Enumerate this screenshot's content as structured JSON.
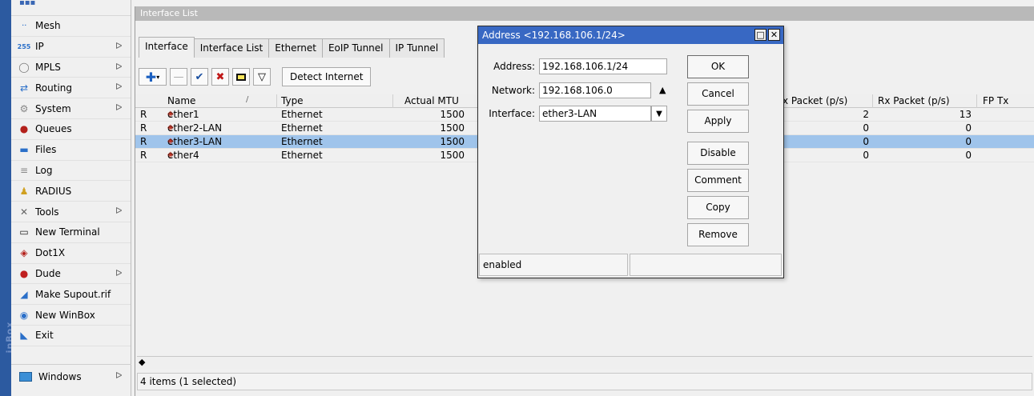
{
  "sidebar": {
    "items": [
      {
        "label": "Mesh",
        "icon": "mesh-icon",
        "arrow": false
      },
      {
        "label": "IP",
        "icon": "ip-icon",
        "arrow": true
      },
      {
        "label": "MPLS",
        "icon": "mpls-icon",
        "arrow": true
      },
      {
        "label": "Routing",
        "icon": "routing-icon",
        "arrow": true
      },
      {
        "label": "System",
        "icon": "system-icon",
        "arrow": true
      },
      {
        "label": "Queues",
        "icon": "queues-icon",
        "arrow": false
      },
      {
        "label": "Files",
        "icon": "files-icon",
        "arrow": false
      },
      {
        "label": "Log",
        "icon": "log-icon",
        "arrow": false
      },
      {
        "label": "RADIUS",
        "icon": "radius-icon",
        "arrow": false
      },
      {
        "label": "Tools",
        "icon": "tools-icon",
        "arrow": true
      },
      {
        "label": "New Terminal",
        "icon": "terminal-icon",
        "arrow": false
      },
      {
        "label": "Dot1X",
        "icon": "dot1x-icon",
        "arrow": false
      },
      {
        "label": "Dude",
        "icon": "dude-icon",
        "arrow": true
      },
      {
        "label": "Make Supout.rif",
        "icon": "supout-icon",
        "arrow": false
      },
      {
        "label": "New WinBox",
        "icon": "winbox-icon",
        "arrow": false
      },
      {
        "label": "Exit",
        "icon": "exit-icon",
        "arrow": false
      }
    ],
    "windows_label": "Windows",
    "side_text": "inBox"
  },
  "iface_window": {
    "title": "Interface List",
    "tabs": [
      "Interface",
      "Interface List",
      "Ethernet",
      "EoIP Tunnel",
      "IP Tunnel"
    ],
    "detect_button": "Detect Internet",
    "columns": {
      "name": "Name",
      "type": "Type",
      "mtu": "Actual MTU",
      "tx": "x Packet (p/s)",
      "rx": "Rx Packet (p/s)",
      "fp": "FP Tx"
    },
    "rows": [
      {
        "flag": "R",
        "name": "ether1",
        "type": "Ethernet",
        "mtu": "1500",
        "tx": "2",
        "rx": "13",
        "selected": false
      },
      {
        "flag": "R",
        "name": "ether2-LAN",
        "type": "Ethernet",
        "mtu": "1500",
        "tx": "0",
        "rx": "0",
        "selected": false
      },
      {
        "flag": "R",
        "name": "ether3-LAN",
        "type": "Ethernet",
        "mtu": "1500",
        "tx": "0",
        "rx": "0",
        "selected": true
      },
      {
        "flag": "R",
        "name": "ether4",
        "type": "Ethernet",
        "mtu": "1500",
        "tx": "0",
        "rx": "0",
        "selected": false
      }
    ],
    "status": "4 items (1 selected)"
  },
  "address_dialog": {
    "title": "Address <192.168.106.1/24>",
    "address_label": "Address:",
    "address_value": "192.168.106.1/24",
    "network_label": "Network:",
    "network_value": "192.168.106.0",
    "interface_label": "Interface:",
    "interface_value": "ether3-LAN",
    "buttons": {
      "ok": "OK",
      "cancel": "Cancel",
      "apply": "Apply",
      "disable": "Disable",
      "comment": "Comment",
      "copy": "Copy",
      "remove": "Remove"
    },
    "status": "enabled"
  },
  "colors": {
    "dialog_title_bg": "#3868c3",
    "selected_row": "#9fc4eb",
    "inactive_title": "#b9b9b9"
  }
}
